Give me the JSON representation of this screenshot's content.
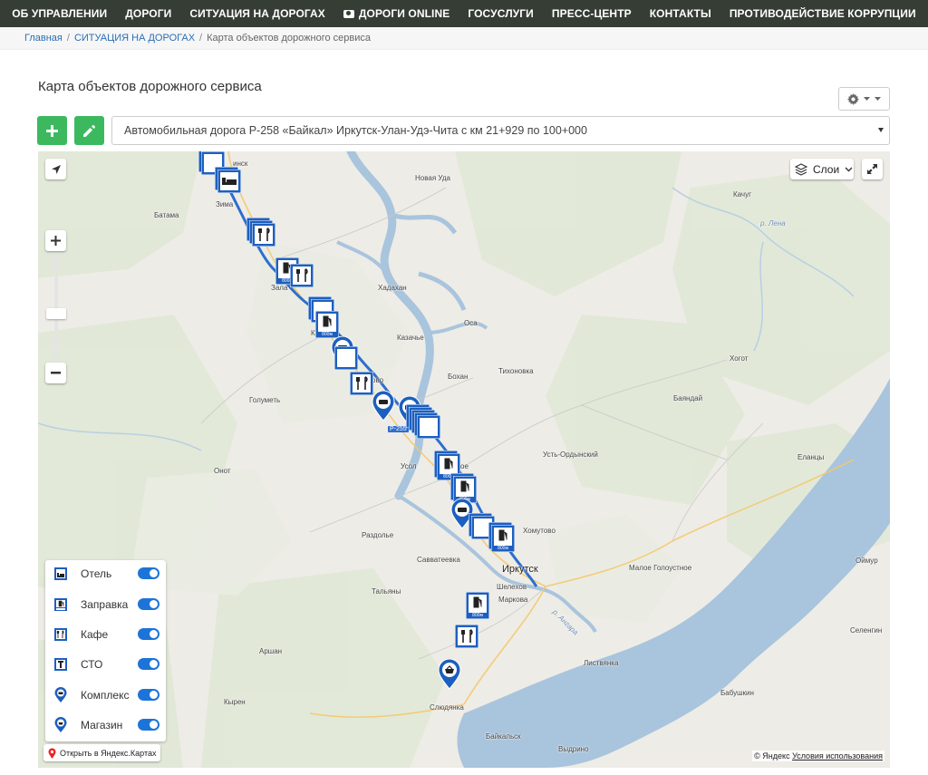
{
  "nav": {
    "items": [
      "ОБ УПРАВЛЕНИИ",
      "ДОРОГИ",
      "СИТУАЦИЯ НА ДОРОГАХ",
      "ДОРОГИ ONLINE",
      "ГОСУСЛУГИ",
      "ПРЕСС-ЦЕНТР",
      "КОНТАКТЫ",
      "ПРОТИВОДЕЙСТВИЕ КОРРУПЦИИ"
    ]
  },
  "breadcrumb": {
    "home": "Главная",
    "section": "СИТУАЦИЯ НА ДОРОГАХ",
    "current": "Карта объектов дорожного сервиса"
  },
  "page": {
    "title": "Карта объектов дорожного сервиса"
  },
  "road_select": {
    "value": "Автомобильная дорога Р-258 «Байкал» Иркутск-Улан-Удэ-Чита с км 21+929 по 100+000"
  },
  "map": {
    "layers_label": "Слои",
    "open_yandex": "Открыть в Яндекс.Картах",
    "copyright_prefix": "© Яндекс",
    "terms": "Условия использования",
    "road_badge": "Р-255",
    "places": {
      "novaya_uda": "Новая Уда",
      "kachug": "Качуг",
      "batama": "Батама",
      "zima": "Зима",
      "r_lena": "р. Лена",
      "khadakhan": "Хадахан",
      "osa": "Оса",
      "kazachye": "Казачье",
      "bokhan": "Бохан",
      "tikhonovka": "Тихоновка",
      "khogot": "Хогот",
      "bayandai": "Баяндай",
      "golumet": "Голуметь",
      "ust_ordynsky": "Усть-Ордынский",
      "elantsy": "Еланцы",
      "onot": "Онот",
      "usolye": "Усол",
      "khomutovo": "Хомутово",
      "razdolye": "Раздолье",
      "savvateevka": "Савватеевка",
      "irkutsk": "Иркутск",
      "maloe_goloustnoe": "Малое Голоустное",
      "oimur": "Оймур",
      "shelekhov": "Шелехов",
      "markova": "Маркова",
      "talyany": "Тальяны",
      "r_angara": "р. Ангара",
      "selenginsk": "Селенгин",
      "arshan": "Аршан",
      "listvyanka": "Листвянка",
      "babushkin": "Бабушкин",
      "kyren": "Кырен",
      "slyudyanka": "Слюдянка",
      "baikalsk": "Байкальск",
      "vydrino": "Выдрино",
      "zima_partial": "Зима",
      "zal": "Зала",
      "kuit": "К",
      "ovo": "ово",
      "oe": "ое",
      "insk": "инск"
    },
    "marker_labels": {
      "dist_800": "800м"
    }
  },
  "legend": {
    "items": [
      {
        "label": "Отель",
        "icon": "hotel-icon",
        "enabled": true
      },
      {
        "label": "Заправка",
        "icon": "fuel-icon",
        "enabled": true
      },
      {
        "label": "Кафе",
        "icon": "cafe-icon",
        "enabled": true
      },
      {
        "label": "СТО",
        "icon": "service-station-icon",
        "enabled": true
      },
      {
        "label": "Комплекс",
        "icon": "complex-pin-icon",
        "enabled": true
      },
      {
        "label": "Магазин",
        "icon": "shop-pin-icon",
        "enabled": true
      }
    ]
  },
  "colors": {
    "nav_bg": "#353d35",
    "accent_green": "#3cb95f",
    "marker_blue": "#1d5fbf",
    "lake": "#a9c4dd",
    "toggle": "#1d74d8"
  }
}
